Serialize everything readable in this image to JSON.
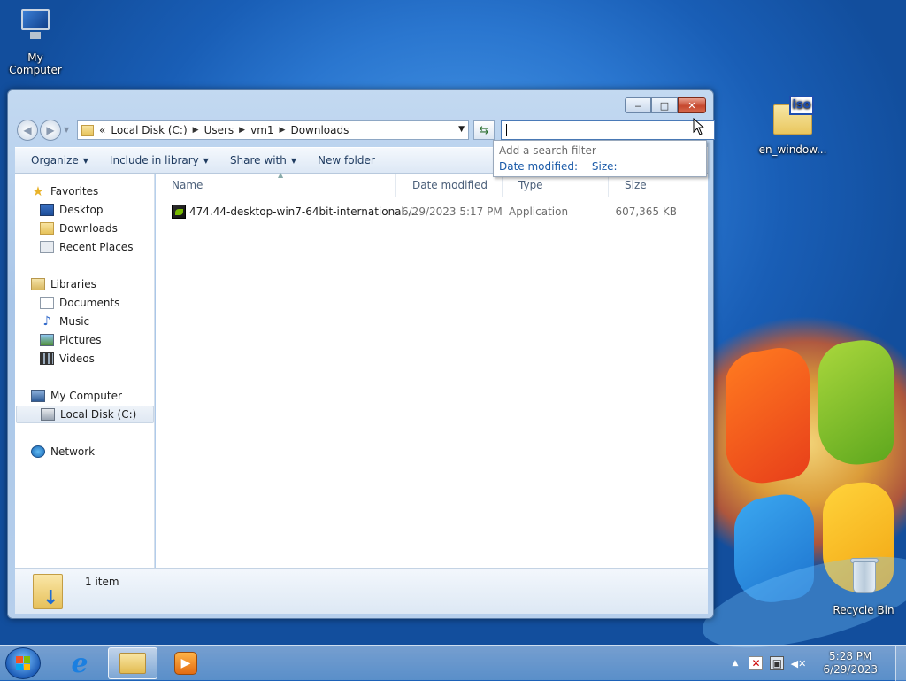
{
  "desktop": {
    "icons": [
      {
        "label": "My Computer",
        "icon": "computer-icon"
      },
      {
        "label": "en_window...",
        "icon": "iso-file-icon",
        "badge": "iso"
      },
      {
        "label": "Recycle Bin",
        "icon": "recycle-bin-icon"
      }
    ]
  },
  "window": {
    "caption_buttons": {
      "minimize": "‒",
      "maximize": "□",
      "close": "✕"
    },
    "address": {
      "overflow": "«",
      "crumbs": [
        "Local Disk (C:)",
        "Users",
        "vm1",
        "Downloads"
      ],
      "separator": "▶"
    },
    "search": {
      "value": ""
    },
    "search_popup": {
      "hint": "Add a search filter",
      "filters": [
        "Date modified:",
        "Size:"
      ]
    },
    "toolbar": {
      "organize": "Organize",
      "include_in_library": "Include in library",
      "share_with": "Share with",
      "new_folder": "New folder"
    },
    "nav": {
      "favorites": "Favorites",
      "desktop": "Desktop",
      "downloads": "Downloads",
      "recent_places": "Recent Places",
      "libraries": "Libraries",
      "documents": "Documents",
      "music": "Music",
      "pictures": "Pictures",
      "videos": "Videos",
      "my_computer": "My Computer",
      "local_disk": "Local Disk (C:)",
      "network": "Network"
    },
    "columns": {
      "name": "Name",
      "date_modified": "Date modified",
      "type": "Type",
      "size": "Size"
    },
    "files": [
      {
        "name": "474.44-desktop-win7-64bit-international....",
        "date_modified": "6/29/2023 5:17 PM",
        "type": "Application",
        "size": "607,365 KB"
      }
    ],
    "details": {
      "count": "1 item"
    }
  },
  "taskbar": {
    "apps": [
      "internet-explorer",
      "windows-explorer",
      "windows-media-player"
    ],
    "active_app": "windows-explorer",
    "clock": {
      "time": "5:28 PM",
      "date": "6/29/2023"
    }
  }
}
